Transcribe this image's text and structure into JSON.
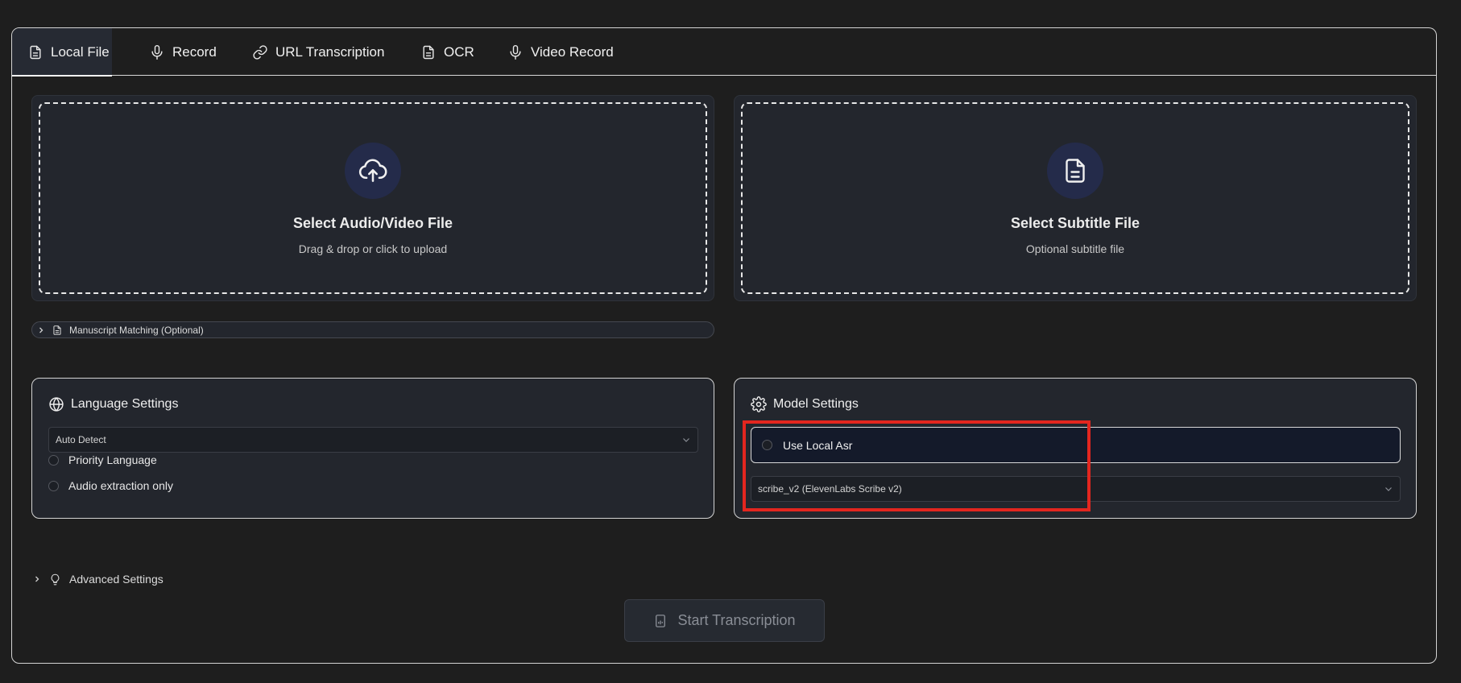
{
  "tabs": [
    {
      "label": "Local File",
      "icon": "file-icon",
      "active": true
    },
    {
      "label": "Record",
      "icon": "microphone-icon"
    },
    {
      "label": "URL Transcription",
      "icon": "link-icon"
    },
    {
      "label": "OCR",
      "icon": "file-text-icon"
    },
    {
      "label": "Video Record",
      "icon": "microphone-icon"
    }
  ],
  "upload": {
    "media": {
      "title": "Select Audio/Video File",
      "subtitle": "Drag & drop or click to upload",
      "icon": "cloud-upload-icon"
    },
    "subtitle_file": {
      "title": "Select Subtitle File",
      "subtitle": "Optional subtitle file",
      "icon": "file-text-icon"
    }
  },
  "manuscript": {
    "label": "Manuscript Matching (Optional)"
  },
  "language_settings": {
    "title": "Language Settings",
    "icon": "globe-icon",
    "language_select": "Auto Detect",
    "priority_language": "Priority Language",
    "audio_extraction_only": "Audio extraction only"
  },
  "model_settings": {
    "title": "Model Settings",
    "icon": "gear-icon",
    "use_local_asr": "Use Local Asr",
    "model_select": "scribe_v2 (ElevenLabs Scribe v2)"
  },
  "advanced": {
    "label": "Advanced Settings",
    "icon": "lightbulb-icon"
  },
  "start_button": {
    "label": "Start Transcription",
    "disabled": true
  },
  "colors": {
    "background": "#1e1e1e",
    "panel": "#23262d",
    "icon_circle": "#242b4a",
    "highlight": "#e3261f",
    "disabled_text": "#8a8e96"
  }
}
